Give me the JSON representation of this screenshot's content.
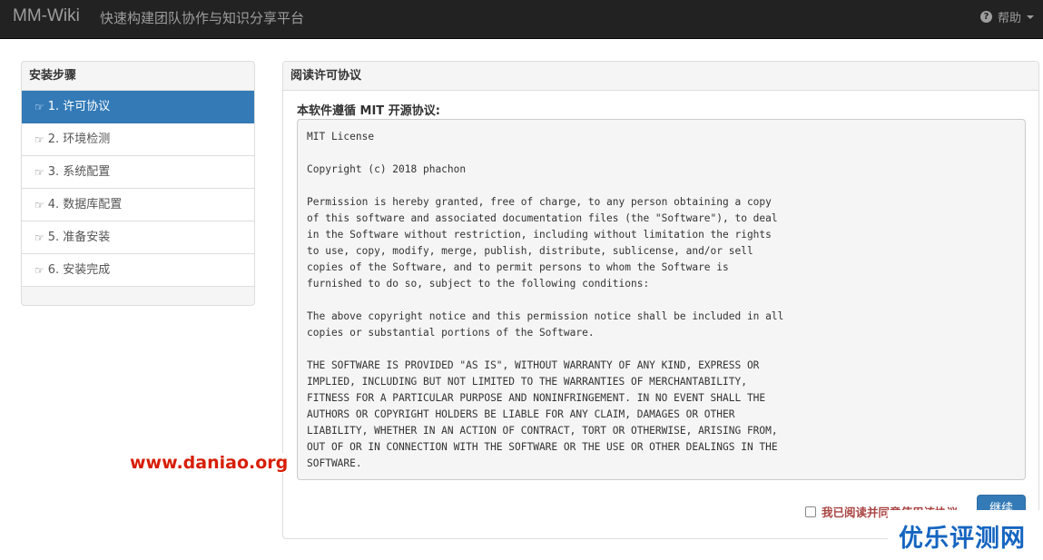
{
  "navbar": {
    "brand": "MM-Wiki",
    "slogan": "快速构建团队协作与知识分享平台",
    "help_label": "帮助",
    "help_icon": "question-circle-icon"
  },
  "sidebar": {
    "title": "安装步骤",
    "items": [
      {
        "label": "1. 许可协议",
        "active": true
      },
      {
        "label": "2. 环境检测",
        "active": false
      },
      {
        "label": "3. 系统配置",
        "active": false
      },
      {
        "label": "4. 数据库配置",
        "active": false
      },
      {
        "label": "5. 准备安装",
        "active": false
      },
      {
        "label": "6. 安装完成",
        "active": false
      }
    ],
    "item_icon": "hand-point-right-icon"
  },
  "main": {
    "title": "阅读许可协议",
    "license_heading": "本软件遵循 MIT 开源协议:",
    "license_text": "MIT License\n\nCopyright (c) 2018 phachon\n\nPermission is hereby granted, free of charge, to any person obtaining a copy\nof this software and associated documentation files (the \"Software\"), to deal\nin the Software without restriction, including without limitation the rights\nto use, copy, modify, merge, publish, distribute, sublicense, and/or sell\ncopies of the Software, and to permit persons to whom the Software is\nfurnished to do so, subject to the following conditions:\n\nThe above copyright notice and this permission notice shall be included in all\ncopies or substantial portions of the Software.\n\nTHE SOFTWARE IS PROVIDED \"AS IS\", WITHOUT WARRANTY OF ANY KIND, EXPRESS OR\nIMPLIED, INCLUDING BUT NOT LIMITED TO THE WARRANTIES OF MERCHANTABILITY,\nFITNESS FOR A PARTICULAR PURPOSE AND NONINFRINGEMENT. IN NO EVENT SHALL THE\nAUTHORS OR COPYRIGHT HOLDERS BE LIABLE FOR ANY CLAIM, DAMAGES OR OTHER\nLIABILITY, WHETHER IN AN ACTION OF CONTRACT, TORT OR OTHERWISE, ARISING FROM,\nOUT OF OR IN CONNECTION WITH THE SOFTWARE OR THE USE OR OTHER DEALINGS IN THE\nSOFTWARE.",
    "agree_label": "我已阅读并同意使用该协议",
    "continue_label": "继续"
  },
  "overlays": {
    "watermark": "www.daniao.org",
    "corner_logo": "优乐评测网"
  },
  "colors": {
    "navbar_bg": "#222222",
    "primary": "#337ab7",
    "agree_text": "#a94442",
    "watermark": "#d81e06",
    "corner_logo": "#1565c0"
  }
}
